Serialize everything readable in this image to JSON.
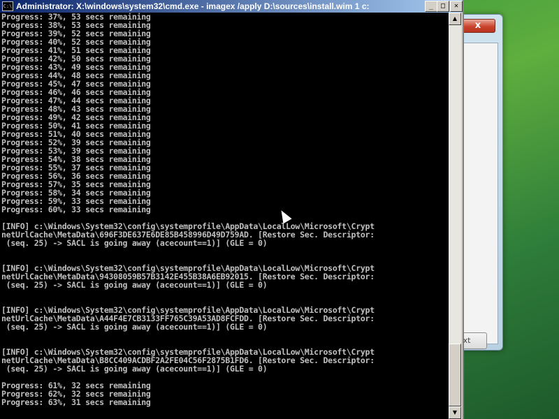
{
  "background_window": {
    "close_glyph": "x",
    "next_label": "xt"
  },
  "console": {
    "title": "Administrator: X:\\windows\\system32\\cmd.exe - imagex  /apply D:\\sources\\install.wim 1 c:",
    "icon_text": "C:\\",
    "controls": {
      "minimize": "_",
      "maximize": "□",
      "close": "✕"
    },
    "lines": [
      "Progress: 37%, 53 secs remaining",
      "Progress: 38%, 53 secs remaining",
      "Progress: 39%, 52 secs remaining",
      "Progress: 40%, 52 secs remaining",
      "Progress: 41%, 51 secs remaining",
      "Progress: 42%, 50 secs remaining",
      "Progress: 43%, 49 secs remaining",
      "Progress: 44%, 48 secs remaining",
      "Progress: 45%, 47 secs remaining",
      "Progress: 46%, 46 secs remaining",
      "Progress: 47%, 44 secs remaining",
      "Progress: 48%, 43 secs remaining",
      "Progress: 49%, 42 secs remaining",
      "Progress: 50%, 41 secs remaining",
      "Progress: 51%, 40 secs remaining",
      "Progress: 52%, 39 secs remaining",
      "Progress: 53%, 39 secs remaining",
      "Progress: 54%, 38 secs remaining",
      "Progress: 55%, 37 secs remaining",
      "Progress: 56%, 36 secs remaining",
      "Progress: 57%, 35 secs remaining",
      "Progress: 58%, 34 secs remaining",
      "Progress: 59%, 33 secs remaining",
      "Progress: 60%, 33 secs remaining",
      "",
      "[INFO] c:\\Windows\\System32\\config\\systemprofile\\AppData\\LocalLow\\Microsoft\\Crypt",
      "netUrlCache\\MetaData\\696F3DE637E6DE85B458996D49D759AD. [Restore Sec. Descriptor:",
      " (seq. 25) -> SACL is going away (acecount==1)] (GLE = 0)",
      "",
      "",
      "[INFO] c:\\Windows\\System32\\config\\systemprofile\\AppData\\LocalLow\\Microsoft\\Crypt",
      "netUrlCache\\MetaData\\94308059B57B3142E455B38A6EB92015. [Restore Sec. Descriptor:",
      " (seq. 25) -> SACL is going away (acecount==1)] (GLE = 0)",
      "",
      "",
      "[INFO] c:\\Windows\\System32\\config\\systemprofile\\AppData\\LocalLow\\Microsoft\\Crypt",
      "netUrlCache\\MetaData\\A44F4E7CB3133FF765C39A53AD8FCFDD. [Restore Sec. Descriptor:",
      " (seq. 25) -> SACL is going away (acecount==1)] (GLE = 0)",
      "",
      "",
      "[INFO] c:\\Windows\\System32\\config\\systemprofile\\AppData\\LocalLow\\Microsoft\\Crypt",
      "netUrlCache\\MetaData\\B8CC409ACDBF2A2FE04C56F2875B1FD6. [Restore Sec. Descriptor:",
      " (seq. 25) -> SACL is going away (acecount==1)] (GLE = 0)",
      "",
      "Progress: 61%, 32 secs remaining",
      "Progress: 62%, 32 secs remaining",
      "Progress: 63%, 31 secs remaining"
    ]
  },
  "colors": {
    "console_bg": "#000000",
    "console_text": "#c0c0c0",
    "titlebar_start": "#0a246a",
    "titlebar_end": "#a6caf0"
  },
  "icons": {
    "mouse_pointer": "arrow-cursor-icon"
  }
}
